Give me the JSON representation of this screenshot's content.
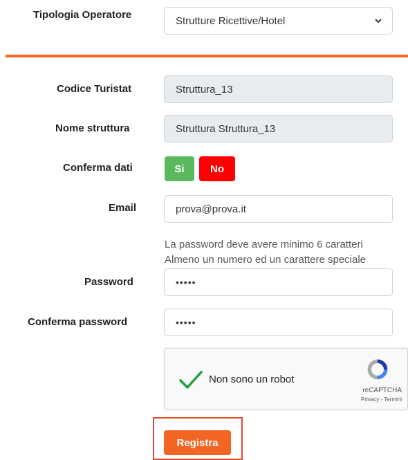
{
  "operator_type": {
    "label": "Tipologia Operatore",
    "value": "Strutture Ricettive/Hotel"
  },
  "form": {
    "codice": {
      "label": "Codice Turistat",
      "value": "Struttura_13"
    },
    "nome": {
      "label": "Nome struttura",
      "value": "Struttura Struttura_13"
    },
    "conferma_dati": {
      "label": "Conferma dati",
      "yes": "Si",
      "no": "No"
    },
    "email": {
      "label": "Email",
      "value": "prova@prova.it"
    },
    "password_hint": [
      "La password deve avere minimo 6 caratteri",
      "Almeno un numero ed un carattere speciale"
    ],
    "password": {
      "label": "Password",
      "value": "•••••"
    },
    "conferma_password": {
      "label": "Conferma password",
      "value": "•••••"
    }
  },
  "captcha": {
    "label": "Non sono un robot",
    "brand": "reCAPTCHA",
    "links": "Privacy - Termini"
  },
  "submit_label": "Registra",
  "colors": {
    "accent": "#f26522",
    "yes": "#5cb85c",
    "no": "#ff0000",
    "check": "#1e9e3e"
  }
}
